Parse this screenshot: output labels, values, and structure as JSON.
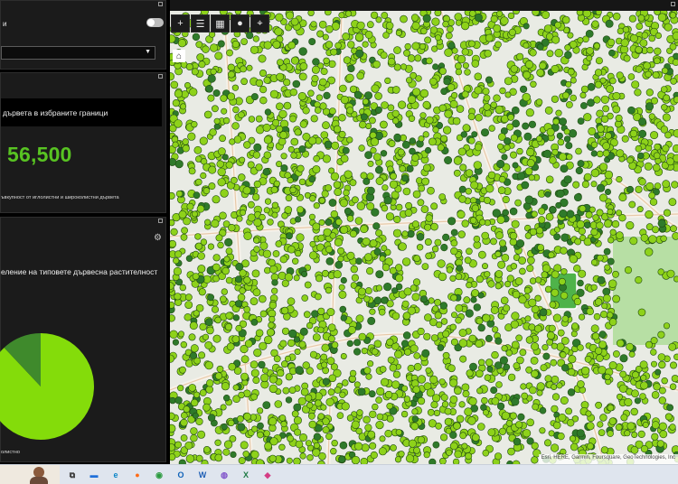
{
  "left_panel": {
    "toggle_label": "и",
    "dropdown_value": "",
    "count_card": {
      "title": "дървета в избраните граници",
      "value": "56,500",
      "caption": "ъвкупност от иглолистни и широколистни дървета"
    },
    "chart_card": {
      "title": "еление на типовете дървесна растителност",
      "legend_text": "олистно"
    }
  },
  "chart_data": {
    "type": "pie",
    "title": "",
    "slices": [
      {
        "label": "",
        "value": 0.88,
        "color": "#84dc0a"
      },
      {
        "label": "",
        "value": 0.12,
        "color": "#3f8a2c"
      }
    ]
  },
  "map": {
    "toolbar": [
      {
        "name": "zoom-tool",
        "icon": "+"
      },
      {
        "name": "list-tool",
        "icon": "☰"
      },
      {
        "name": "grid-tool",
        "icon": "▦"
      },
      {
        "name": "layer-tool",
        "icon": "●"
      },
      {
        "name": "select-tool",
        "icon": "⌖"
      }
    ],
    "home_icon": "⌂",
    "attribution": "Esri, HERE, Garmin, Foursquare, GeoTechnologies, Inc"
  },
  "colors": {
    "accent_green": "#58c322",
    "tree_light": "#8ed21a",
    "tree_dark": "#2f7a2a",
    "panel_bg": "#1b1b1b",
    "map_bg": "#e9ebe4"
  },
  "taskbar": {
    "icons": [
      {
        "name": "task-view-icon",
        "glyph": "⧉",
        "color": "#333"
      },
      {
        "name": "file-explorer-icon",
        "glyph": "▬",
        "color": "#1e6fd9"
      },
      {
        "name": "edge-icon",
        "glyph": "e",
        "color": "#0a84c6"
      },
      {
        "name": "firefox-icon",
        "glyph": "●",
        "color": "#ff6b15"
      },
      {
        "name": "chrome-icon",
        "glyph": "◉",
        "color": "#2a9a3e"
      },
      {
        "name": "outlook-icon",
        "glyph": "O",
        "color": "#0f62b8"
      },
      {
        "name": "word-icon",
        "glyph": "W",
        "color": "#1d5eb5"
      },
      {
        "name": "viber-icon",
        "glyph": "◍",
        "color": "#7d4fc9"
      },
      {
        "name": "excel-icon",
        "glyph": "X",
        "color": "#1e7a44"
      },
      {
        "name": "paint-icon",
        "glyph": "◆",
        "color": "#d43c84"
      }
    ]
  }
}
